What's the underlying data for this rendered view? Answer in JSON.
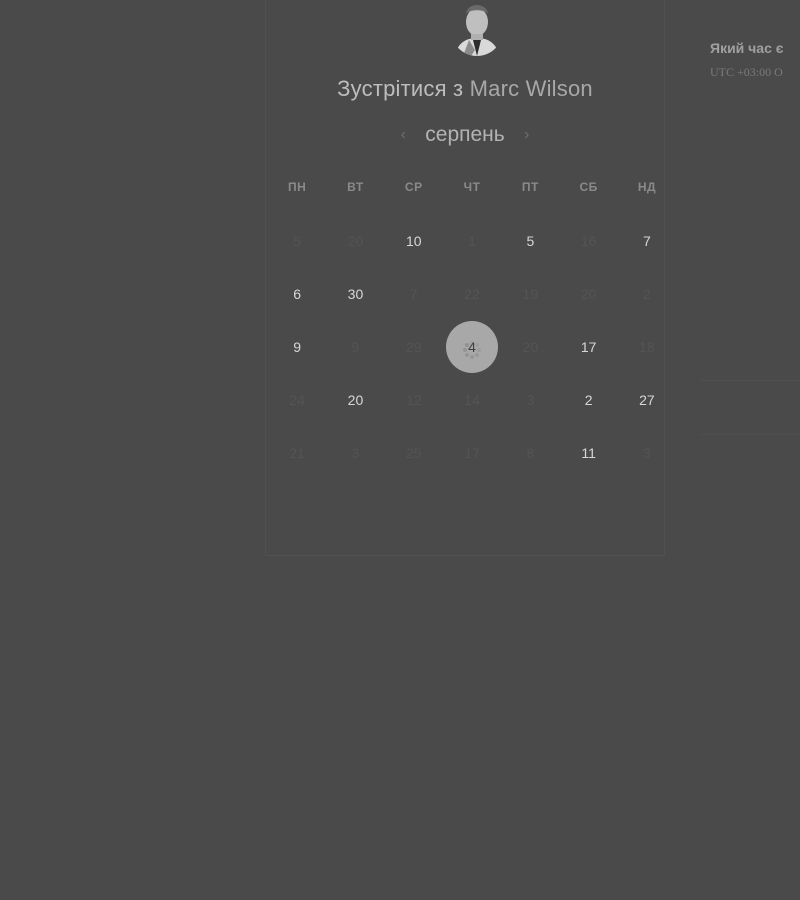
{
  "header": {
    "title_prefix": "Зустрітися з",
    "host_name": "Marc Wilson"
  },
  "calendar": {
    "month": "серпень",
    "prev_icon": "chevron-left-icon",
    "next_icon": "chevron-right-icon",
    "weekdays": [
      "ПН",
      "ВТ",
      "СР",
      "ЧТ",
      "ПТ",
      "СБ",
      "НД"
    ],
    "days": [
      {
        "label": "5",
        "state": "disabled"
      },
      {
        "label": "20",
        "state": "disabled"
      },
      {
        "label": "10",
        "state": "available"
      },
      {
        "label": "1",
        "state": "disabled"
      },
      {
        "label": "5",
        "state": "available"
      },
      {
        "label": "16",
        "state": "disabled"
      },
      {
        "label": "7",
        "state": "available"
      },
      {
        "label": "6",
        "state": "available"
      },
      {
        "label": "30",
        "state": "available"
      },
      {
        "label": "7",
        "state": "disabled"
      },
      {
        "label": "22",
        "state": "disabled"
      },
      {
        "label": "19",
        "state": "disabled"
      },
      {
        "label": "20",
        "state": "disabled"
      },
      {
        "label": "2",
        "state": "disabled"
      },
      {
        "label": "9",
        "state": "available"
      },
      {
        "label": "9",
        "state": "disabled"
      },
      {
        "label": "29",
        "state": "disabled"
      },
      {
        "label": "4",
        "state": "selected"
      },
      {
        "label": "20",
        "state": "disabled"
      },
      {
        "label": "17",
        "state": "available"
      },
      {
        "label": "18",
        "state": "disabled"
      },
      {
        "label": "24",
        "state": "disabled"
      },
      {
        "label": "20",
        "state": "available"
      },
      {
        "label": "12",
        "state": "disabled"
      },
      {
        "label": "14",
        "state": "disabled"
      },
      {
        "label": "3",
        "state": "disabled"
      },
      {
        "label": "2",
        "state": "available"
      },
      {
        "label": "27",
        "state": "available"
      },
      {
        "label": "21",
        "state": "disabled"
      },
      {
        "label": "3",
        "state": "disabled"
      },
      {
        "label": "25",
        "state": "disabled"
      },
      {
        "label": "17",
        "state": "disabled"
      },
      {
        "label": "8",
        "state": "disabled"
      },
      {
        "label": "11",
        "state": "available"
      },
      {
        "label": "3",
        "state": "disabled"
      }
    ]
  },
  "timezone": {
    "question": "Який час є",
    "value": "UTC +03:00 O"
  },
  "colors": {
    "background": "#4a4a4a",
    "selected_circle": "#a8a8a8",
    "available_text": "#d7d7d7",
    "disabled_text": "#545454"
  }
}
